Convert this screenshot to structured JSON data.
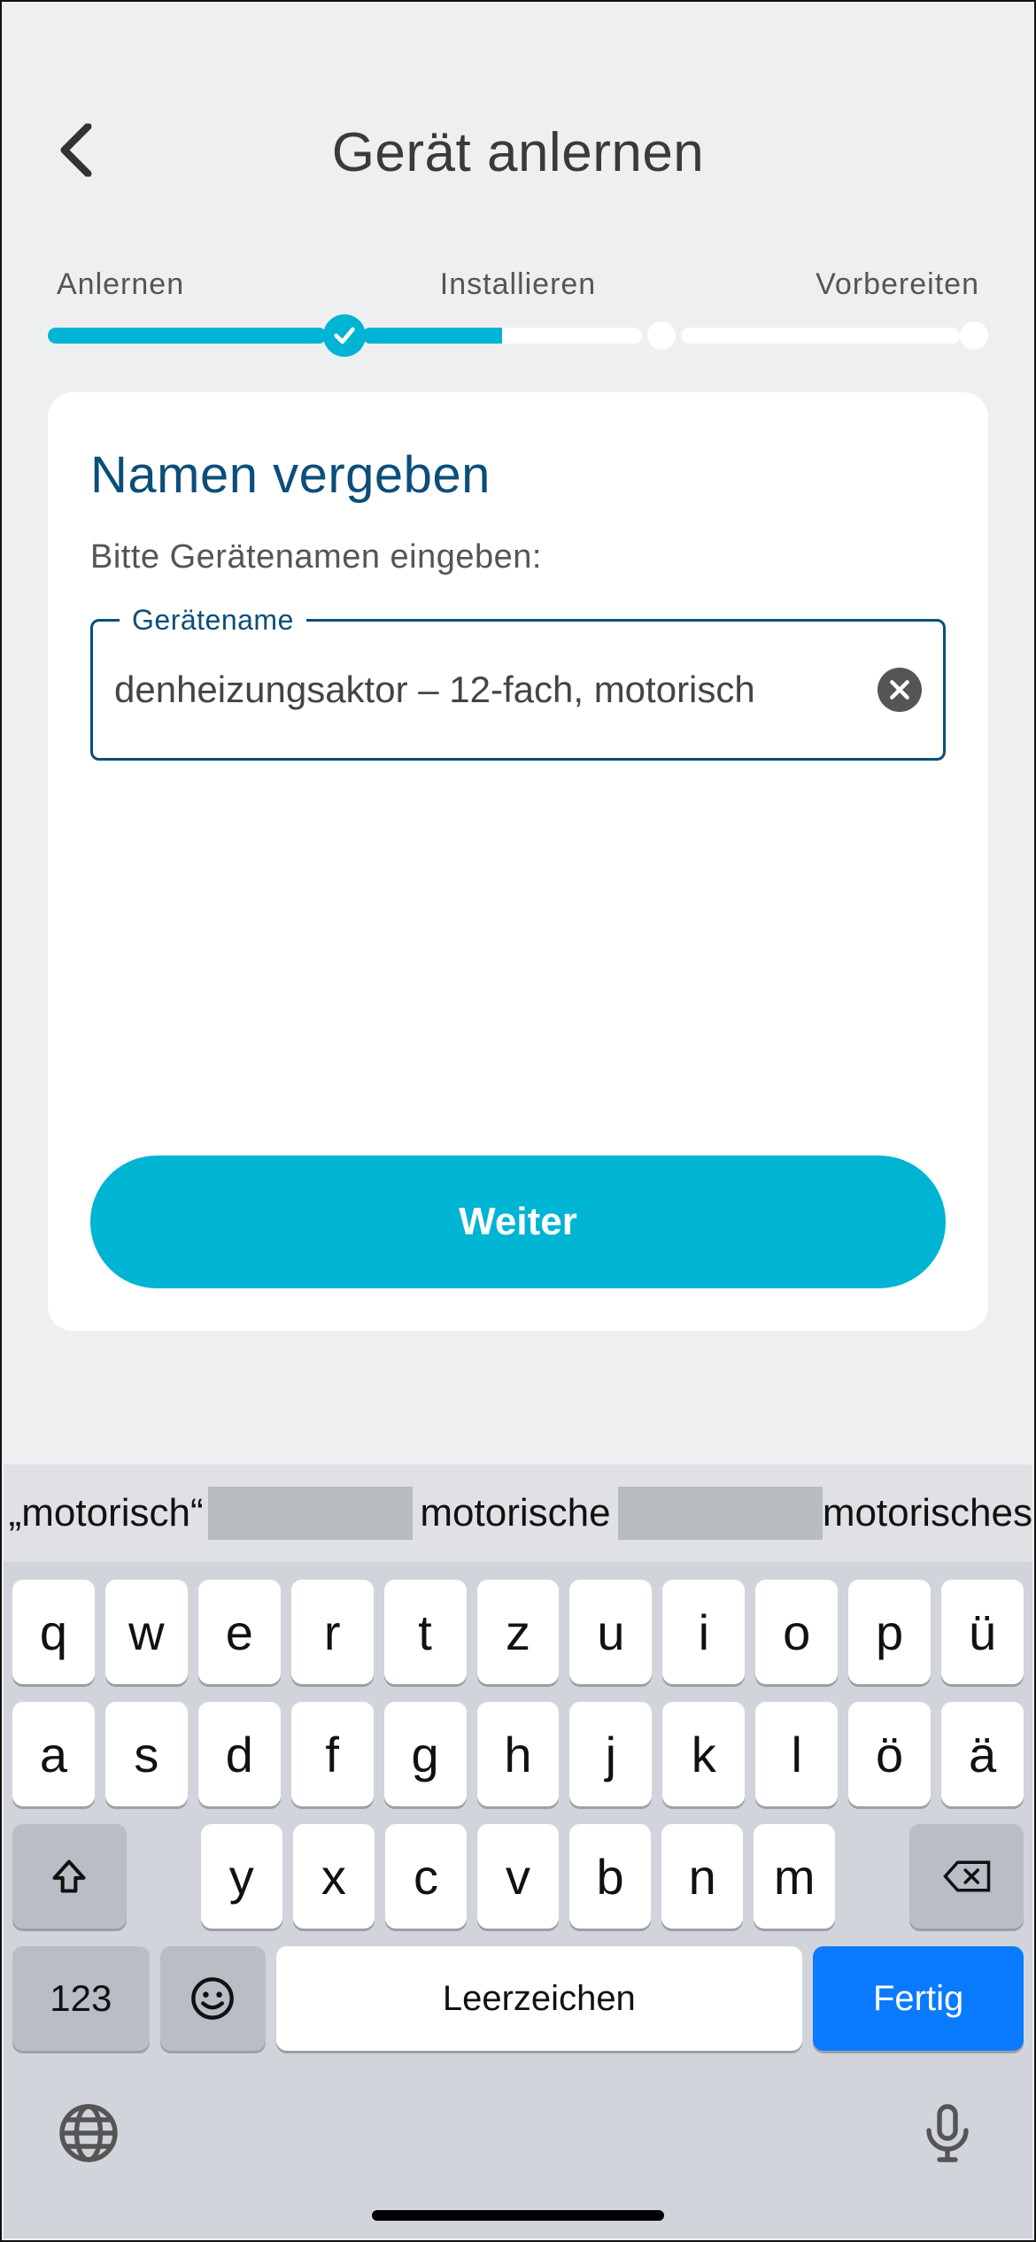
{
  "header": {
    "title": "Gerät anlernen"
  },
  "steps": {
    "s1": "Anlernen",
    "s2": "Installieren",
    "s3": "Vorbereiten"
  },
  "card": {
    "title": "Namen vergeben",
    "subtitle": "Bitte Gerätenamen eingeben:",
    "field_label": "Gerätename",
    "field_value": "denheizungsaktor – 12-fach, motorisch",
    "primary": "Weiter"
  },
  "keyboard": {
    "suggestions": [
      "„motorisch“",
      "motorische",
      "motorisches"
    ],
    "row1": [
      "q",
      "w",
      "e",
      "r",
      "t",
      "z",
      "u",
      "i",
      "o",
      "p",
      "ü"
    ],
    "row2": [
      "a",
      "s",
      "d",
      "f",
      "g",
      "h",
      "j",
      "k",
      "l",
      "ö",
      "ä"
    ],
    "row3": [
      "y",
      "x",
      "c",
      "v",
      "b",
      "n",
      "m"
    ],
    "numKey": "123",
    "space": "Leerzeichen",
    "done": "Fertig"
  }
}
